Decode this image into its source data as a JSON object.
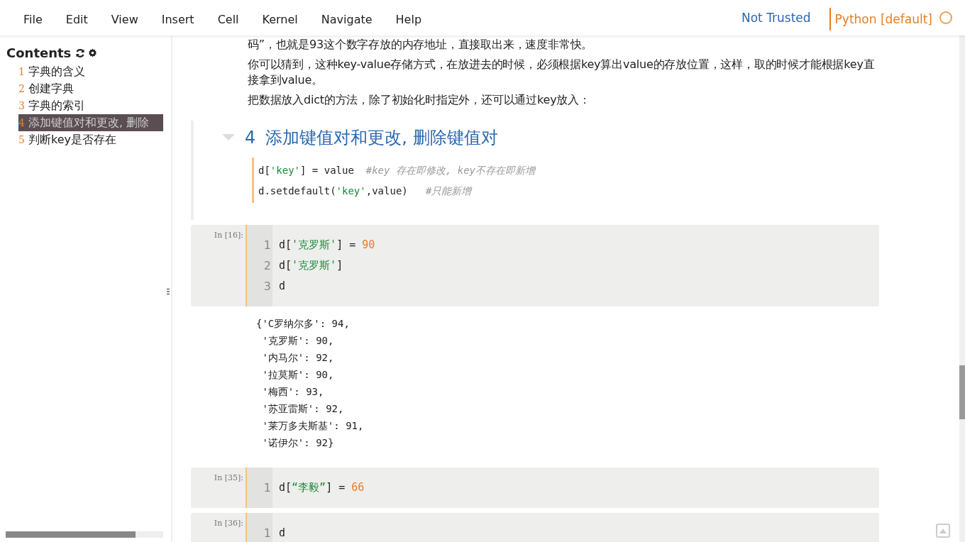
{
  "menu": [
    "File",
    "Edit",
    "View",
    "Insert",
    "Cell",
    "Kernel",
    "Navigate",
    "Help"
  ],
  "trust_status": "Not Trusted",
  "kernel": {
    "name": "Python [default]",
    "busy": false
  },
  "toc": {
    "title": "Contents",
    "items": [
      {
        "number": "1",
        "label": "字典的含义",
        "selected": false
      },
      {
        "number": "2",
        "label": "创建字典",
        "selected": false
      },
      {
        "number": "3",
        "label": "字典的索引",
        "selected": false
      },
      {
        "number": "4",
        "label": "添加键值对和更改, 删除",
        "selected": true
      },
      {
        "number": "5",
        "label": "判断key是否存在",
        "selected": false
      }
    ]
  },
  "paragraphs": [
    "码”，也就是93这个数字存放的内存地址，直接取出来，速度非常快。",
    "你可以猜到，这种key-value存储方式，在放进去的时候，必须根据key算出value的存放位置，这样，取的时候才能根据key直接拿到value。",
    "把数据放入dict的方法，除了初始化时指定外，还可以通过key放入："
  ],
  "heading": {
    "number": "4",
    "text": "添加键值对和更改, 删除键值对"
  },
  "snippet": [
    [
      {
        "kind": "plain",
        "text": "d["
      },
      {
        "kind": "string",
        "text": "'key'"
      },
      {
        "kind": "plain",
        "text": "] = value  "
      },
      {
        "kind": "comment",
        "text": "#key 存在即修改, key不存在即新增"
      }
    ],
    [
      {
        "kind": "plain",
        "text": "d.setdefault("
      },
      {
        "kind": "string",
        "text": "'key'"
      },
      {
        "kind": "plain",
        "text": ",value)   "
      },
      {
        "kind": "comment",
        "text": "#只能新增"
      }
    ]
  ],
  "cells": [
    {
      "prompt": "In [16]:",
      "lines": [
        {
          "number": "1",
          "tokens": [
            {
              "kind": "plain",
              "text": "d["
            },
            {
              "kind": "string",
              "text": "'克罗斯'"
            },
            {
              "kind": "plain",
              "text": "] = "
            },
            {
              "kind": "number",
              "text": "90"
            }
          ]
        },
        {
          "number": "2",
          "tokens": [
            {
              "kind": "plain",
              "text": "d["
            },
            {
              "kind": "string",
              "text": "'克罗斯'"
            },
            {
              "kind": "plain",
              "text": "]"
            }
          ]
        },
        {
          "number": "3",
          "tokens": [
            {
              "kind": "plain",
              "text": "d"
            }
          ]
        }
      ],
      "output": [
        "{'C罗纳尔多': 94,",
        " '克罗斯': 90,",
        " '内马尔': 92,",
        " '拉莫斯': 90,",
        " '梅西': 93,",
        " '苏亚雷斯': 92,",
        " '莱万多夫斯基': 91,",
        " '诺伊尔': 92}"
      ]
    },
    {
      "prompt": "In [35]:",
      "lines": [
        {
          "number": "1",
          "tokens": [
            {
              "kind": "plain",
              "text": "d["
            },
            {
              "kind": "string",
              "text": "“李毅”"
            },
            {
              "kind": "plain",
              "text": "] = "
            },
            {
              "kind": "number",
              "text": "66"
            }
          ]
        }
      ]
    },
    {
      "prompt": "In [36]:",
      "lines": [
        {
          "number": "1",
          "tokens": [
            {
              "kind": "plain",
              "text": "d"
            }
          ]
        }
      ]
    }
  ]
}
